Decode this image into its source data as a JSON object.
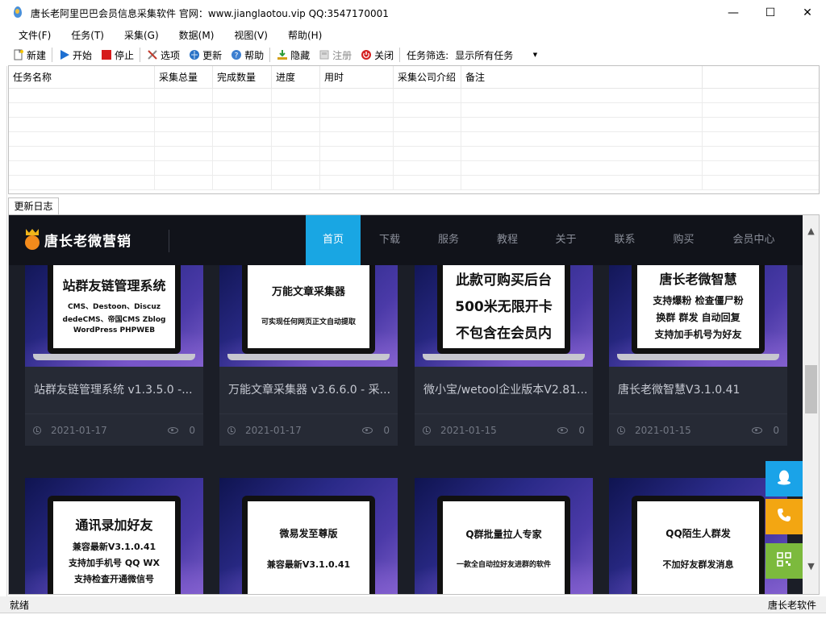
{
  "window": {
    "title": "唐长老阿里巴巴会员信息采集软件 官网：www.jianglaotou.vip QQ:3547170001",
    "minimize": "—",
    "maximize": "☐",
    "close": "✕"
  },
  "menu": [
    "文件(F)",
    "任务(T)",
    "采集(G)",
    "数据(M)",
    "视图(V)",
    "帮助(H)"
  ],
  "toolbar": {
    "new": "新建",
    "start": "开始",
    "stop": "停止",
    "options": "选项",
    "update": "更新",
    "help": "帮助",
    "hide": "隐藏",
    "register": "注册",
    "close": "关闭",
    "filter_label": "任务筛选:",
    "filter_value": "显示所有任务"
  },
  "task_table": {
    "columns": [
      "任务名称",
      "采集总量",
      "完成数量",
      "进度",
      "用时",
      "采集公司介绍",
      "备注"
    ],
    "rows": []
  },
  "log_tab": "更新日志",
  "website": {
    "logo": "唐长老微营销",
    "nav": [
      "首页",
      "下载",
      "服务",
      "教程",
      "关于",
      "联系",
      "购买",
      "会员中心"
    ],
    "active_nav": "首页",
    "cards": [
      {
        "screen_lines": [
          "站群友链管理系统",
          "CMS、Destoon、Discuz",
          "dedeCMS、帝国CMS Zblog",
          "WordPress PHPWEB"
        ],
        "title": "站群友链管理系统 v1.3.5.0 -...",
        "date": "2021-01-17",
        "views": "0"
      },
      {
        "screen_lines": [
          "万能文章采集器",
          "可实现任何网页正文自动提取"
        ],
        "title": "万能文章采集器 v3.6.6.0 - 采...",
        "date": "2021-01-17",
        "views": "0"
      },
      {
        "screen_lines": [
          "此款可购买后台",
          "500米无限开卡",
          "不包含在会员内"
        ],
        "title": "微小宝/wetool企业版本V2.81...",
        "date": "2021-01-15",
        "views": "0"
      },
      {
        "screen_lines": [
          "唐长老微智慧",
          "支持爆粉 检查僵尸粉",
          "换群 群发 自动回复",
          "支持加手机号为好友"
        ],
        "title": "唐长老微智慧V3.1.0.41",
        "date": "2021-01-15",
        "views": "0"
      },
      {
        "screen_lines": [
          "通讯录加好友",
          "兼容最新V3.1.0.41",
          "支持加手机号 QQ WX",
          "支持检查开通微信号"
        ]
      },
      {
        "screen_lines": [
          "微易发至尊版",
          "兼容最新V3.1.0.41"
        ]
      },
      {
        "screen_lines": [
          "Q群批量拉人专家",
          "一款全自动拉好友进群的软件"
        ]
      },
      {
        "screen_lines": [
          "QQ陌生人群发",
          "不加好友群发消息"
        ]
      }
    ]
  },
  "statusbar": {
    "left": "就绪",
    "right": "唐长老软件"
  },
  "colors": {
    "nav_active": "#19a6e3",
    "float_qq": "#1aa3e8",
    "float_phone": "#f3a612",
    "float_qr": "#7cba3d"
  }
}
